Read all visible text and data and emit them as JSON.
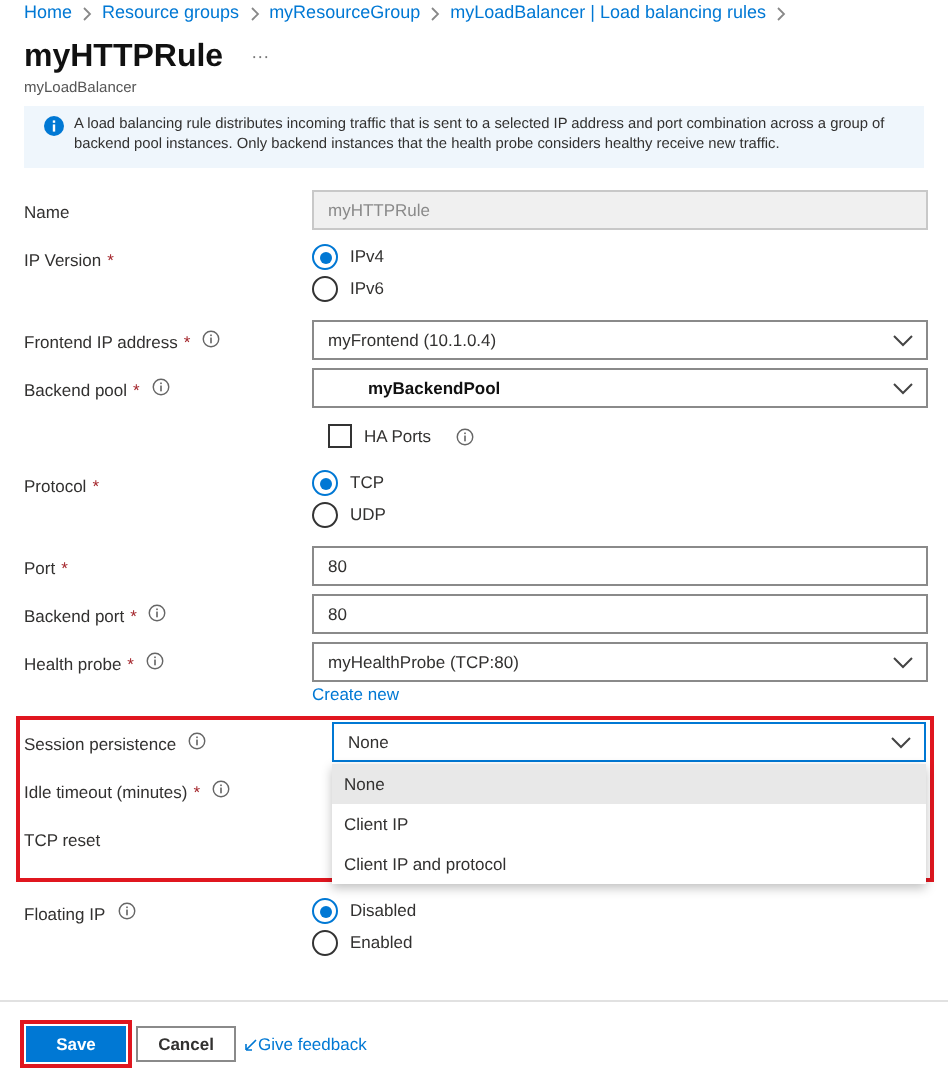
{
  "breadcrumb": [
    "Home",
    "Resource groups",
    "myResourceGroup",
    "myLoadBalancer | Load balancing rules"
  ],
  "title": "myHTTPRule",
  "more": "···",
  "subtitle": "myLoadBalancer",
  "info": "A load balancing rule distributes incoming traffic that is sent to a selected IP address and port combination across a group of backend pool instances. Only backend instances that the health probe considers healthy receive new traffic.",
  "fields": [
    {
      "label": "Name",
      "info": false,
      "highlighted": false,
      "control": {
        "kind": "text",
        "value": "myHTTPRule",
        "disabled": true
      }
    },
    {
      "label": "IP Version",
      "required_mark": "*",
      "info": false,
      "highlighted": false,
      "control": {
        "kind": "radio",
        "options": [
          {
            "label": "IPv4",
            "selected": true
          },
          {
            "label": "IPv6",
            "selected": false
          }
        ]
      }
    },
    {
      "label": "Frontend IP address",
      "required_mark": "*",
      "info": true,
      "highlighted": false,
      "control": {
        "kind": "select",
        "value": "myFrontend (10.1.0.4)",
        "bold": false
      }
    },
    {
      "label": "Backend pool",
      "required_mark": "*",
      "info": true,
      "highlighted": false,
      "control": {
        "kind": "select",
        "value": "myBackendPool",
        "bold": true
      }
    },
    {
      "info": false,
      "highlighted": false,
      "control": {
        "kind": "checkbox",
        "label": "HA Ports",
        "checked": false,
        "info": true
      }
    },
    {
      "label": "Protocol",
      "required_mark": "*",
      "info": false,
      "highlighted": false,
      "control": {
        "kind": "radio",
        "options": [
          {
            "label": "TCP",
            "selected": true
          },
          {
            "label": "UDP",
            "selected": false
          }
        ]
      }
    },
    {
      "label": "Port",
      "required_mark": "*",
      "info": false,
      "highlighted": false,
      "control": {
        "kind": "text",
        "value": "80",
        "disabled": false
      }
    },
    {
      "label": "Backend port",
      "required_mark": "*",
      "info": true,
      "highlighted": false,
      "control": {
        "kind": "text",
        "value": "80",
        "disabled": false
      }
    },
    {
      "label": "Health probe",
      "required_mark": "*",
      "info": true,
      "highlighted": false,
      "control": {
        "kind": "select",
        "value": "myHealthProbe (TCP:80)",
        "bold": false,
        "link": "Create new"
      }
    },
    {
      "label": "Session persistence",
      "info": true,
      "highlighted": true,
      "control": {
        "kind": "select",
        "value": "None",
        "bold": false,
        "focused": true,
        "options": [
          {
            "label": "None",
            "selected": true
          },
          {
            "label": "Client IP",
            "selected": false
          },
          {
            "label": "Client IP and protocol",
            "selected": false
          }
        ]
      }
    },
    {
      "label": "Idle timeout (minutes)",
      "required_mark": "*",
      "info": true,
      "highlighted": true,
      "control": {
        "kind": "hidden"
      }
    },
    {
      "label": "TCP reset",
      "info": false,
      "highlighted": true,
      "control": {
        "kind": "hidden"
      }
    },
    {
      "label": "Floating IP",
      "info": true,
      "highlighted": false,
      "control": {
        "kind": "radio",
        "options": [
          {
            "label": "Disabled",
            "selected": true
          },
          {
            "label": "Enabled",
            "selected": false
          }
        ]
      }
    }
  ],
  "buttons": [
    {
      "label": "Save",
      "kind": "primary",
      "highlighted": true
    },
    {
      "label": "Cancel",
      "kind": "secondary",
      "highlighted": false
    }
  ],
  "feedback": "Give feedback"
}
